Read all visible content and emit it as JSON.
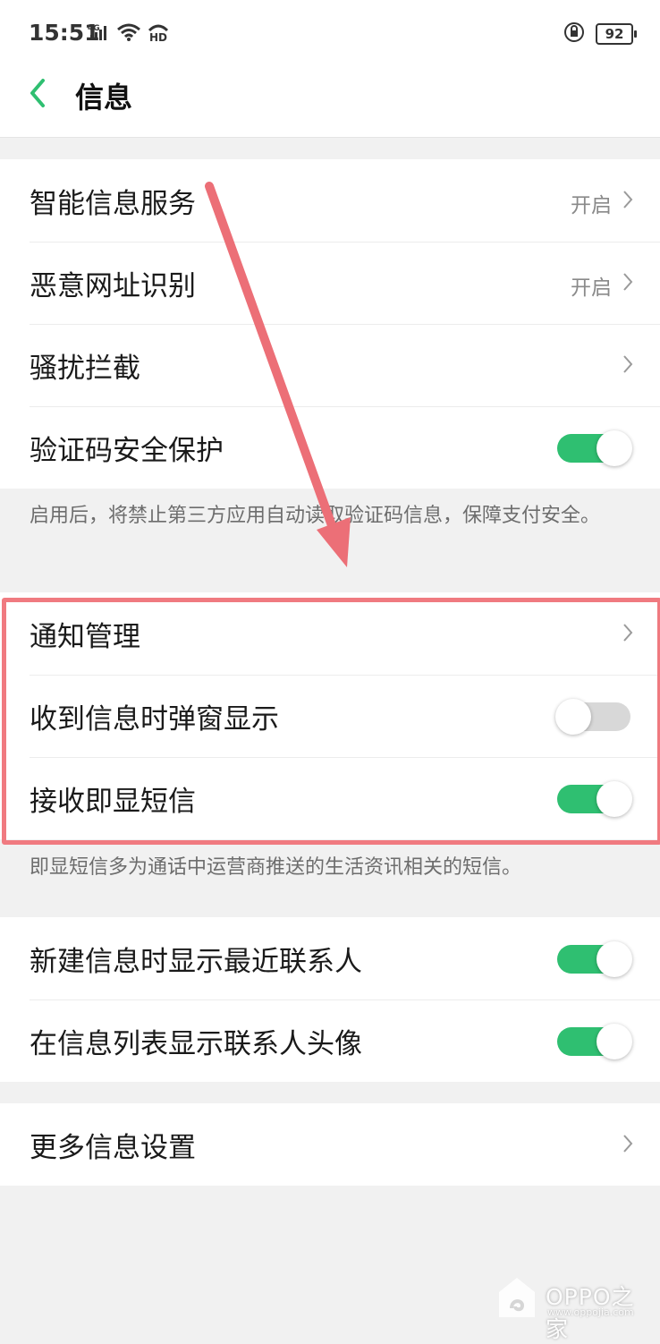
{
  "status_bar": {
    "time": "15:51",
    "network": "4G",
    "hd": "HD",
    "battery": "92"
  },
  "nav": {
    "title": "信息"
  },
  "groups": [
    {
      "rows": [
        {
          "label": "智能信息服务",
          "value": "开启",
          "type": "link"
        },
        {
          "label": "恶意网址识别",
          "value": "开启",
          "type": "link"
        },
        {
          "label": "骚扰拦截",
          "value": "",
          "type": "link"
        },
        {
          "label": "验证码安全保护",
          "type": "toggle",
          "on": true
        }
      ],
      "note": "启用后，将禁止第三方应用自动读取验证码信息，保障支付安全。"
    },
    {
      "rows": [
        {
          "label": "通知管理",
          "type": "link"
        },
        {
          "label": "收到信息时弹窗显示",
          "type": "toggle",
          "on": false
        },
        {
          "label": "接收即显短信",
          "type": "toggle",
          "on": true
        }
      ],
      "note": "即显短信多为通话中运营商推送的生活资讯相关的短信。"
    },
    {
      "rows": [
        {
          "label": "新建信息时显示最近联系人",
          "type": "toggle",
          "on": true
        },
        {
          "label": "在信息列表显示联系人头像",
          "type": "toggle",
          "on": true
        }
      ]
    },
    {
      "rows": [
        {
          "label": "更多信息设置",
          "type": "link"
        }
      ]
    }
  ],
  "watermark": {
    "brand": "OPPO之家",
    "url": "www.oppojia.com"
  },
  "colors": {
    "accent": "#2fbf71",
    "highlight": "#f07a80",
    "toggle_off": "#d8d8d8"
  }
}
